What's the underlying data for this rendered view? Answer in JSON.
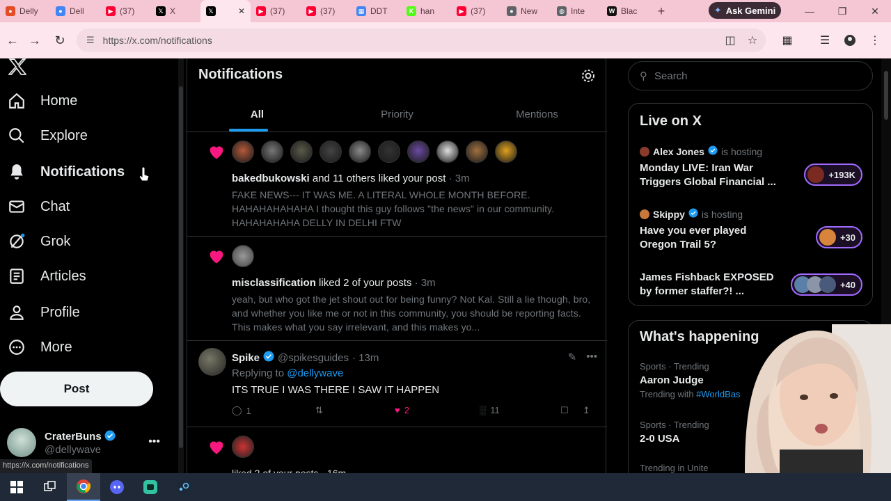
{
  "browser": {
    "tabs": [
      {
        "label": "Delly",
        "icon": "chrome-icon",
        "color": "#e34c26"
      },
      {
        "label": "Dell",
        "icon": "chrome-icon",
        "color": "#4285f4"
      },
      {
        "label": "(37)",
        "icon": "youtube-icon",
        "color": "#ff0033"
      },
      {
        "label": "X",
        "icon": "x-icon",
        "color": "#000000"
      },
      {
        "label": "",
        "icon": "x-icon",
        "color": "#000000",
        "active": true
      },
      {
        "label": "(37)",
        "icon": "youtube-icon",
        "color": "#ff0033"
      },
      {
        "label": "(37)",
        "icon": "youtube-icon",
        "color": "#ff0033"
      },
      {
        "label": "DDT",
        "icon": "calendar-icon",
        "color": "#4285f4"
      },
      {
        "label": "han",
        "icon": "kick-icon",
        "color": "#53fc18"
      },
      {
        "label": "(37)",
        "icon": "youtube-icon",
        "color": "#ff0033"
      },
      {
        "label": "New",
        "icon": "chrome-icon",
        "color": "#5f6368"
      },
      {
        "label": "Inte",
        "icon": "globe-icon",
        "color": "#5f6368"
      },
      {
        "label": "Blac",
        "icon": "wix-icon",
        "color": "#111111"
      }
    ],
    "ask_gemini": "Ask Gemini",
    "url": "https://x.com/notifications"
  },
  "nav": {
    "items": [
      {
        "label": "Home",
        "icon": "home-icon"
      },
      {
        "label": "Explore",
        "icon": "search-icon"
      },
      {
        "label": "Notifications",
        "icon": "bell-icon",
        "active": true
      },
      {
        "label": "Chat",
        "icon": "mail-icon"
      },
      {
        "label": "Grok",
        "icon": "grok-icon"
      },
      {
        "label": "Articles",
        "icon": "article-icon"
      },
      {
        "label": "Profile",
        "icon": "profile-icon"
      },
      {
        "label": "More",
        "icon": "more-circle-icon"
      }
    ],
    "post_label": "Post",
    "account": {
      "name": "CraterBuns",
      "handle": "@dellywave"
    },
    "status_url": "https://x.com/notifications"
  },
  "main": {
    "title": "Notifications",
    "tabs": [
      "All",
      "Priority",
      "Mentions"
    ],
    "notifications": [
      {
        "actor": "bakedbukowski",
        "action": " and 11 others liked your post",
        "time": " · 3m",
        "body": "FAKE NEWS--- IT WAS ME.  A LITERAL WHOLE MONTH BEFORE.  HAHAHAHAHAHA  I thought this guy follows \"the news\" in our community.  HAHAHAHAHA DELLY IN DELHI FTW"
      },
      {
        "actor": "misclassification",
        "action": " liked 2 of your posts",
        "time": " · 3m",
        "body": "yeah, but who got the jet shout out for being funny?  Not Kal.  Still a lie though, bro, and whether you like me or not in this community, you should be reporting facts.  This makes what you say irrelevant, and this makes yo..."
      }
    ],
    "reply": {
      "name": "Spike",
      "handle": "@spikesguides",
      "time": "· 13m",
      "replying_prefix": "Replying to ",
      "replying_to": "@dellywave",
      "text": "ITS TRUE I WAS THERE I SAW IT HAPPEN",
      "replies": "1",
      "likes": "2",
      "views": "11"
    },
    "partial_text": "liked 2 of your posts · 16m"
  },
  "right": {
    "search_placeholder": "Search",
    "live_title": "Live on X",
    "live": [
      {
        "host": "Alex Jones",
        "suffix": "is hosting",
        "title": "Monday LIVE: Iran War Triggers Global Financial ...",
        "count": "+193K"
      },
      {
        "host": "Skippy",
        "suffix": "is hosting",
        "title": "Have you ever played Oregon Trail 5?",
        "count": "+30"
      },
      {
        "host": "",
        "suffix": "",
        "title": "James Fishback EXPOSED by former staffer?! ...",
        "count": "+40"
      }
    ],
    "happening_title": "What's happening",
    "trends": [
      {
        "category": "Sports · Trending",
        "title": "Aaron Judge",
        "with_prefix": "Trending with ",
        "with_tag": "#WorldBas"
      },
      {
        "category": "Sports · Trending",
        "title": "2-0 USA"
      },
      {
        "category": "Trending in Unite"
      }
    ]
  },
  "colors": {
    "accent": "#1d9bf0",
    "like": "#f91880",
    "live_border": "#a26bff"
  }
}
